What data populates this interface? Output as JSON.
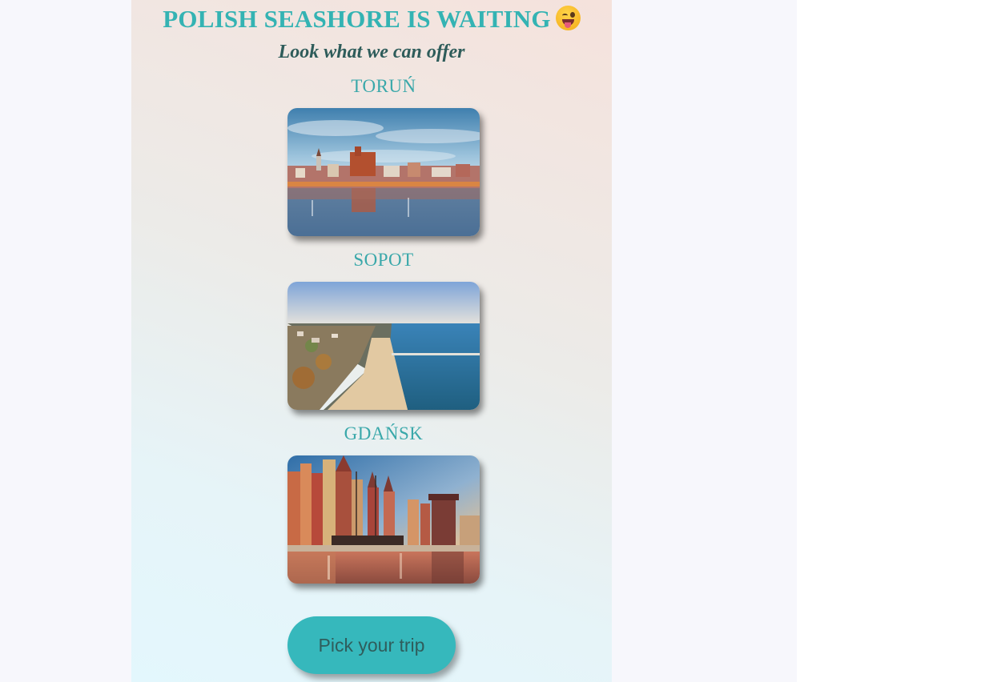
{
  "header": {
    "title": "POLISH SEASHORE IS WAITING",
    "emoji": "winking-tongue-face",
    "subtitle": "Look what we can offer"
  },
  "cities": [
    {
      "name": "TORUŃ",
      "image": "torun-river-panorama"
    },
    {
      "name": "SOPOT",
      "image": "sopot-beach-aerial"
    },
    {
      "name": "GDAŃSK",
      "image": "gdansk-old-town-waterfront"
    }
  ],
  "cta": {
    "label": "Pick your trip"
  },
  "colors": {
    "accent": "#34b3b3",
    "subtitle": "#2e5c5a",
    "button": "#36b8bc",
    "button_text": "#2f5d5c",
    "page_bg": "#f7f7fc"
  }
}
